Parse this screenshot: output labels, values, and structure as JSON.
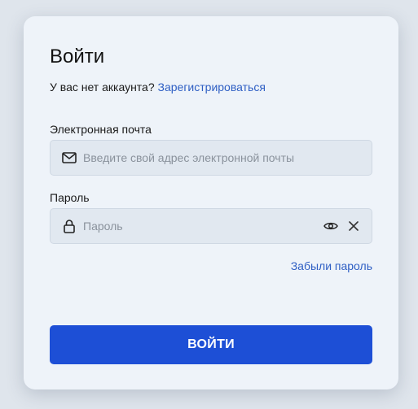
{
  "form": {
    "title": "Войти",
    "signup_prompt": "У вас нет аккаунта?",
    "signup_link": "Зарегистрироваться",
    "email": {
      "label": "Электронная почта",
      "value": "",
      "placeholder": "Введите свой адрес электронной почты",
      "icon": "mail-icon"
    },
    "password": {
      "label": "Пароль",
      "value": "",
      "placeholder": "Пароль",
      "icon": "lock-icon",
      "toggle_icon": "eye-icon",
      "clear_icon": "close-icon"
    },
    "forgot_link": "Забыли пароль",
    "submit_label": "ВОЙТИ"
  },
  "colors": {
    "background": "#dfe5ec",
    "card": "#eef3f9",
    "field": "#e1e8f0",
    "link": "#2f5fc4",
    "primary": "#1d4fd6"
  }
}
